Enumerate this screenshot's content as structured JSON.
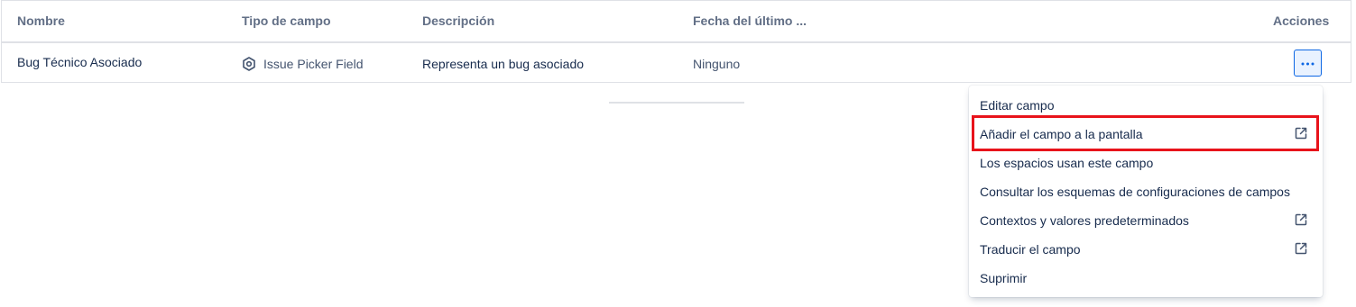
{
  "table": {
    "headers": {
      "name": "Nombre",
      "field_type": "Tipo de campo",
      "description": "Descripción",
      "last_date": "Fecha del último ...",
      "actions": "Acciones"
    },
    "row": {
      "name": "Bug Técnico Asociado",
      "field_type": "Issue Picker Field",
      "field_type_icon": "hexagon-icon",
      "description": "Representa un bug asociado",
      "last_date": "Ninguno",
      "actions_icon": "more-horizontal-icon"
    }
  },
  "menu": {
    "items": [
      {
        "label": "Editar campo",
        "external": false
      },
      {
        "label": "Añadir el campo a la pantalla",
        "external": true,
        "highlighted": true
      },
      {
        "label": "Los espacios usan este campo",
        "external": false
      },
      {
        "label": "Consultar los esquemas de configuraciones de campos",
        "external": false
      },
      {
        "label": "Contextos y valores predeterminados",
        "external": true
      },
      {
        "label": "Traducir el campo",
        "external": true
      },
      {
        "label": "Suprimir",
        "external": false
      }
    ]
  },
  "colors": {
    "accent": "#0c66e4",
    "highlight": "#e8131b",
    "header_text": "#626f86"
  }
}
